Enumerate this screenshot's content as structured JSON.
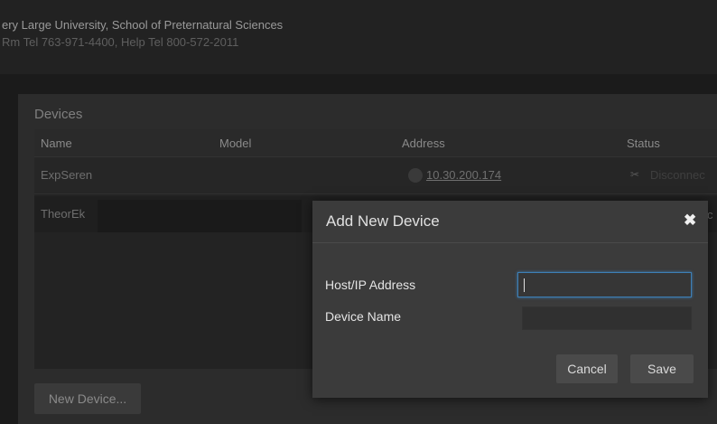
{
  "header": {
    "org_name": "ery Large University, School of Preternatural Sciences",
    "org_phone": "Rm Tel 763-971-4400, Help Tel 800-572-2011"
  },
  "devices": {
    "title": "Devices",
    "columns": [
      "Name",
      "Model",
      "Address",
      "Status"
    ],
    "rows": [
      {
        "name": "ExpSeren",
        "model": "",
        "address": "10.30.200.174",
        "status": "Disconnec"
      },
      {
        "name": "TheorEk",
        "model": "",
        "address": "",
        "status": "c"
      }
    ],
    "new_device_label": "New Device..."
  },
  "modal": {
    "title": "Add New Device",
    "close_icon": "close-icon",
    "host_label": "Host/IP Address",
    "host_value": "",
    "name_label": "Device Name",
    "name_value": "",
    "cancel_label": "Cancel",
    "save_label": "Save"
  },
  "colors": {
    "focus_border": "#3d7fb6",
    "modal_bg": "#3b3b3b",
    "page_bg": "#1b1b1b"
  }
}
